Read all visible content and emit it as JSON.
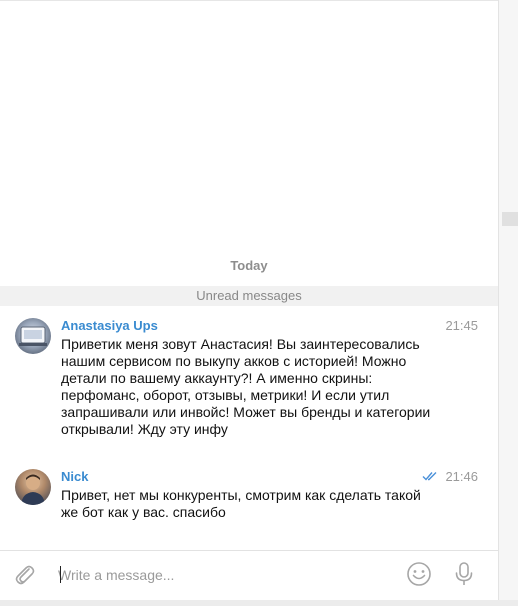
{
  "chat": {
    "date_separator": "Today",
    "unread_separator": "Unread messages",
    "messages": [
      {
        "sender": "Anastasiya Ups",
        "time": "21:45",
        "text": "Приветик меня зовут Анастасия! Вы заинтересовались нашим сервисом по выкупу акков с историей! Можно детали по вашему аккаунту?! А именно скрины: перфоманс, оборот, отзывы, метрики! И если утил запрашивали или инвойс! Может вы бренды и категории открывали! Жду эту инфу",
        "avatar": "user-photo"
      },
      {
        "sender": "Nick",
        "time": "21:46",
        "status": "read",
        "status_icon": "double-check-icon",
        "text": "Привет, нет мы конкуренты, смотрим как сделать такой же бот как у вас. спасибо",
        "avatar": "user-photo"
      }
    ]
  },
  "composer": {
    "placeholder": "Write a message...",
    "value": "",
    "attach_icon": "paperclip-icon",
    "emoji_icon": "smiley-icon",
    "mic_icon": "microphone-icon"
  },
  "colors": {
    "sender_name": "#3a8bd0",
    "check_mark": "#4a90d9",
    "unread_bar": "#f1f1f1",
    "timestamp": "#9a9a9a"
  }
}
